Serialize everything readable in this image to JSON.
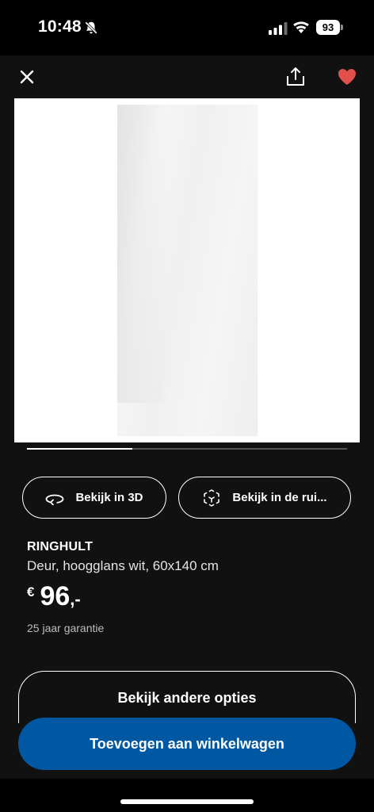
{
  "status_bar": {
    "time": "10:48",
    "battery": "93"
  },
  "gallery": {
    "progress": 0.33
  },
  "actions": {
    "view_3d_label": "Bekijk in 3D",
    "view_room_label": "Bekijk in de rui..."
  },
  "product": {
    "name": "RINGHULT",
    "description": "Deur, hoogglans wit, 60x140 cm",
    "price_currency": "€",
    "price_value": "96",
    "price_suffix": ",-",
    "warranty": "25 jaar garantie"
  },
  "buttons": {
    "other_options_label": "Bekijk andere opties",
    "add_to_cart_label": "Toevoegen aan winkelwagen"
  },
  "colors": {
    "accent_blue": "#0058a3",
    "heart_red": "#e2504c",
    "background": "#111111"
  },
  "icons": [
    "bell-muted-icon",
    "signal-icon",
    "wifi-icon",
    "battery-icon",
    "close-icon",
    "share-icon",
    "heart-icon",
    "rotate-3d-icon",
    "ar-cube-icon"
  ]
}
